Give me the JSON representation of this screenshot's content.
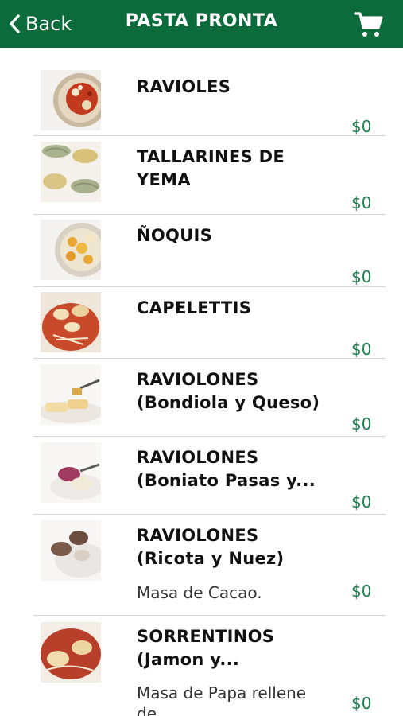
{
  "header": {
    "back_label": "Back",
    "title": "PASTA PRONTA",
    "bar_color": "#0b6b3a"
  },
  "items": [
    {
      "name_line1": "RAVIOLES",
      "name_line2": "",
      "description": "",
      "price": "$0",
      "thumb": "ravioles-photo"
    },
    {
      "name_line1": "TALLARINES DE",
      "name_line2": "YEMA",
      "description": "",
      "price": "$0",
      "thumb": "tallarines-photo"
    },
    {
      "name_line1": "ÑOQUIS",
      "name_line2": "",
      "description": "",
      "price": "$0",
      "thumb": "noquis-photo"
    },
    {
      "name_line1": "CAPELETTIS",
      "name_line2": "",
      "description": "",
      "price": "$0",
      "thumb": "capelettis-photo"
    },
    {
      "name_line1": "RAVIOLONES",
      "name_line2": "(Bondiola y Queso)",
      "description": "",
      "price": "$0",
      "thumb": "raviolones-bondiola-photo"
    },
    {
      "name_line1": "RAVIOLONES",
      "name_line2": "(Boniato Pasas y...",
      "description": "",
      "price": "$0",
      "thumb": "raviolones-boniato-photo"
    },
    {
      "name_line1": "RAVIOLONES",
      "name_line2": "(Ricota y Nuez)",
      "description": "Masa de Cacao.",
      "price": "$0",
      "thumb": "raviolones-ricota-photo"
    },
    {
      "name_line1": "SORRENTINOS",
      "name_line2": "(Jamon y...",
      "description": "Masa de Papa rellene de...",
      "price": "$0",
      "thumb": "sorrentinos-photo"
    }
  ],
  "colors": {
    "price": "#1e7e4e",
    "divider": "#d6d6d6"
  }
}
